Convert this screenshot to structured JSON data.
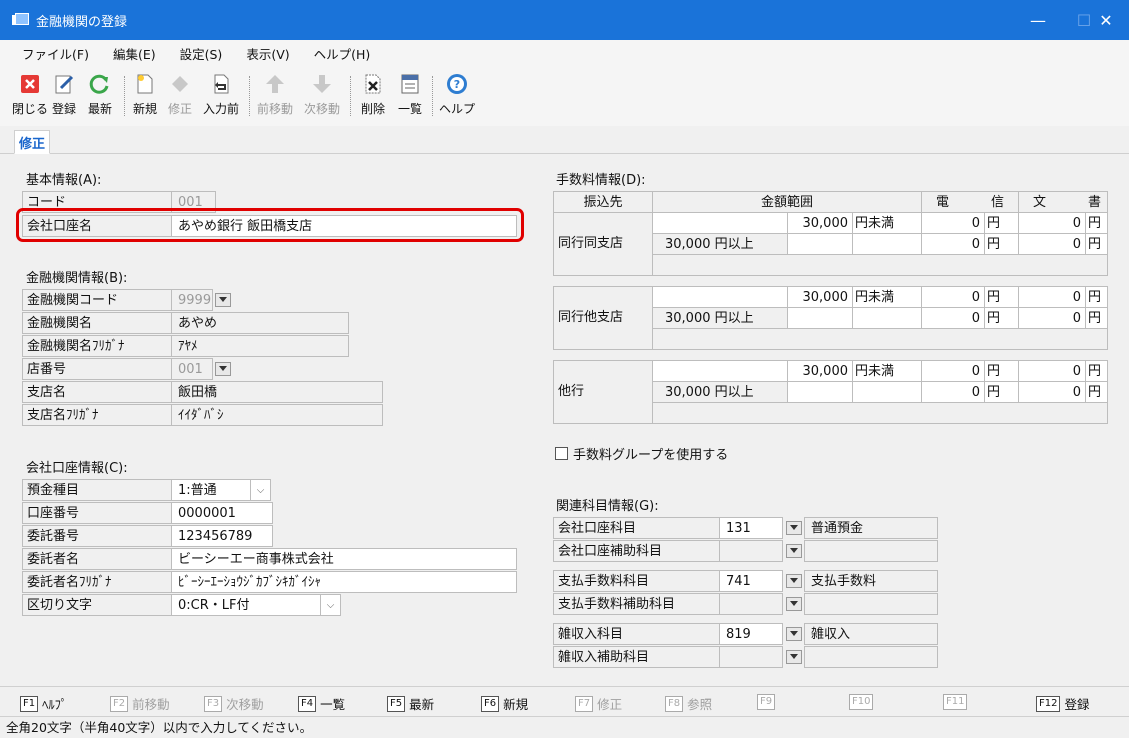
{
  "window": {
    "title": "金融機関の登録"
  },
  "menu": [
    "ファイル(F)",
    "編集(E)",
    "設定(S)",
    "表示(V)",
    "ヘルプ(H)"
  ],
  "toolbar": [
    {
      "label": "閉じる",
      "icon": "close-icon"
    },
    {
      "label": "登録",
      "icon": "register-icon"
    },
    {
      "label": "最新",
      "icon": "refresh-icon"
    },
    {
      "label": "新規",
      "icon": "new-icon"
    },
    {
      "label": "修正",
      "icon": "edit-icon",
      "disabled": true
    },
    {
      "label": "入力前",
      "icon": "undo-icon"
    },
    {
      "label": "前移動",
      "icon": "up-arrow-icon",
      "disabled": true
    },
    {
      "label": "次移動",
      "icon": "down-arrow-icon",
      "disabled": true
    },
    {
      "label": "削除",
      "icon": "delete-icon"
    },
    {
      "label": "一覧",
      "icon": "list-icon"
    },
    {
      "label": "ヘルプ",
      "icon": "help-icon"
    }
  ],
  "tab": "修正",
  "basic": {
    "title": "基本情報(A):",
    "code_label": "コード",
    "code": "001",
    "account_name_label": "会社口座名",
    "account_name": "あやめ銀行 飯田橋支店"
  },
  "bank": {
    "title": "金融機関情報(B):",
    "code_label": "金融機関コード",
    "code": "9999",
    "name_label": "金融機関名",
    "name": "あやめ",
    "kana_label": "金融機関名ﾌﾘｶﾞﾅ",
    "kana": "ｱﾔﾒ",
    "branch_no_label": "店番号",
    "branch_no": "001",
    "branch_label": "支店名",
    "branch": "飯田橋",
    "branch_kana_label": "支店名ﾌﾘｶﾞﾅ",
    "branch_kana": "ｲｲﾀﾞﾊﾞｼ"
  },
  "account": {
    "title": "会社口座情報(C):",
    "type_label": "預金種目",
    "type": "1:普通",
    "number_label": "口座番号",
    "number": "0000001",
    "consign_no_label": "委託番号",
    "consign_no": "123456789",
    "consignor_label": "委託者名",
    "consignor": "ビーシーエー商事株式会社",
    "consignor_kana_label": "委託者名ﾌﾘｶﾞﾅ",
    "consignor_kana": "ﾋﾞｰｼｰｴｰｼｮｳｼﾞｶﾌﾞｼｷｶﾞｲｼｬ",
    "delimiter_label": "区切り文字",
    "delimiter": "0:CR・LF付"
  },
  "fees": {
    "title": "手数料情報(D):",
    "headers": [
      "振込先",
      "金額範囲",
      "電",
      "信",
      "文",
      "書"
    ],
    "under_amount": "30,000",
    "under_unit": "円未満",
    "over_amount": "30,000",
    "over_unit": "円以上",
    "zero": "0",
    "yen": "円",
    "groups": [
      "同行同支店",
      "同行他支店",
      "他行"
    ],
    "use_group_label": "手数料グループを使用する"
  },
  "accounts_rel": {
    "title": "関連科目情報(G):",
    "rows": [
      {
        "label": "会社口座科目",
        "code": "131",
        "name": "普通預金"
      },
      {
        "label": "会社口座補助科目",
        "code": "",
        "name": ""
      },
      {
        "label": "支払手数料科目",
        "code": "741",
        "name": "支払手数料"
      },
      {
        "label": "支払手数料補助科目",
        "code": "",
        "name": ""
      },
      {
        "label": "雑収入科目",
        "code": "819",
        "name": "雑収入"
      },
      {
        "label": "雑収入補助科目",
        "code": "",
        "name": ""
      }
    ]
  },
  "fkeys": [
    {
      "key": "F1",
      "label": "ﾍﾙﾌﾟ"
    },
    {
      "key": "F2",
      "label": "前移動",
      "disabled": true
    },
    {
      "key": "F3",
      "label": "次移動",
      "disabled": true
    },
    {
      "key": "F4",
      "label": "一覧"
    },
    {
      "key": "F5",
      "label": "最新"
    },
    {
      "key": "F6",
      "label": "新規"
    },
    {
      "key": "F7",
      "label": "修正",
      "disabled": true
    },
    {
      "key": "F8",
      "label": "参照",
      "disabled": true
    },
    {
      "key": "F9",
      "label": "",
      "disabled": true
    },
    {
      "key": "F10",
      "label": "",
      "disabled": true
    },
    {
      "key": "F11",
      "label": "",
      "disabled": true
    },
    {
      "key": "F12",
      "label": "登録"
    }
  ],
  "status": "全角20文字（半角40文字）以内で入力してください。",
  "colors": {
    "titlebar": "#1a73d9",
    "highlight": "#e00000",
    "tab_text": "#1a66cc"
  }
}
